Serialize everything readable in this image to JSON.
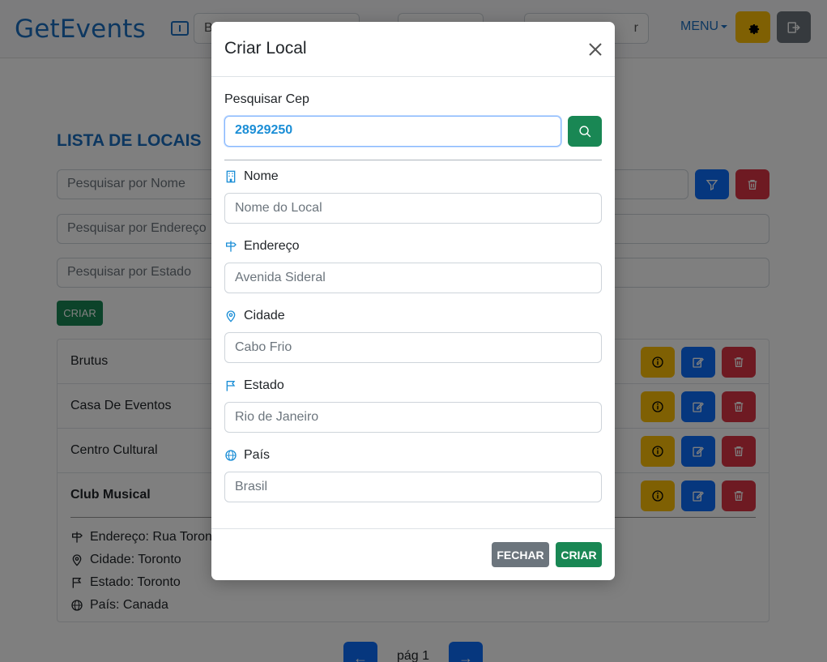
{
  "navbar": {
    "brand": "GetEvents",
    "search_partial": "B",
    "select_partial": "r",
    "menu_label": "MENU"
  },
  "page": {
    "title": "LISTA DE LOCAIS",
    "filters": {
      "name_placeholder": "Pesquisar por Nome",
      "address_placeholder": "Pesquisar por Endereço",
      "state_placeholder": "Pesquisar por Estado"
    },
    "create_label": "CRIAR",
    "places": [
      {
        "name": "Brutus"
      },
      {
        "name": "Casa De Eventos"
      },
      {
        "name": "Centro Cultural"
      },
      {
        "name": "Club Musical"
      }
    ],
    "expanded": {
      "address": "Endereço: Rua Toront",
      "city": "Cidade: Toronto",
      "state": "Estado: Toronto",
      "country": "País: Canada"
    },
    "pager": {
      "page_label": "pág 1",
      "prev": "←",
      "next": "→"
    }
  },
  "modal": {
    "title": "Criar Local",
    "cep_label": "Pesquisar Cep",
    "cep_value": "28929250",
    "fields": {
      "nome": {
        "label": "Nome",
        "placeholder": "Nome do Local"
      },
      "endereco": {
        "label": "Endereço",
        "placeholder": "Avenida Sideral"
      },
      "cidade": {
        "label": "Cidade",
        "placeholder": "Cabo Frio"
      },
      "estado": {
        "label": "Estado",
        "placeholder": "Rio de Janeiro"
      },
      "pais": {
        "label": "País",
        "placeholder": "Brasil"
      }
    },
    "close_label": "FECHAR",
    "create_label": "CRIAR"
  },
  "colors": {
    "primary": "#0d6efd",
    "brand": "#1b6fc1",
    "success": "#198754",
    "danger": "#dc3545",
    "warning": "#ffc107",
    "secondary": "#6c757d"
  },
  "icons": [
    "ticket-icon",
    "gear-icon",
    "logout-icon",
    "filter-icon",
    "trash-icon",
    "info-icon",
    "edit-icon",
    "search-icon",
    "building-icon",
    "signpost-icon",
    "map-pin-icon",
    "flag-icon",
    "globe-icon",
    "close-icon"
  ]
}
